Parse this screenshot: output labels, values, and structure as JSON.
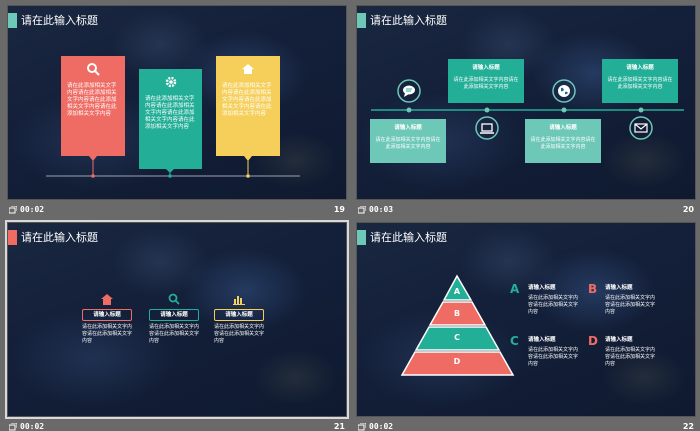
{
  "slides": [
    {
      "number": "19",
      "time": "00:02",
      "title": "请在此输入标题",
      "accent": "#6dc8b8",
      "cards": [
        {
          "text": "请在此添加相关文字内容请在此添加相关文字内容请在此添加相关文字内容请在此添加相关文字内容",
          "icon": "search-icon",
          "color": "#ef6c65"
        },
        {
          "text": "请在此添加相关文字内容请在此添加相关文字内容请在此添加相关文字内容请在此添加相关文字内容",
          "icon": "gear-icon",
          "color": "#23ae97"
        },
        {
          "text": "请在此添加相关文字内容请在此添加相关文字内容请在此添加相关文字内容请在此添加相关文字内容",
          "icon": "home-icon",
          "color": "#f5cf5a"
        }
      ]
    },
    {
      "number": "20",
      "time": "00:03",
      "title": "请在此输入标题",
      "accent": "#6dc8b8",
      "items": [
        {
          "title": "请输入标题",
          "text": "请在此添加相关文字内容请在此添加相关文字内容",
          "icon": "chat-icon"
        },
        {
          "title": "请输入标题",
          "text": "请在此添加相关文字内容请在此添加相关文字内容",
          "icon": "laptop-icon"
        },
        {
          "title": "请输入标题",
          "text": "请在此添加相关文字内容请在此添加相关文字内容",
          "icon": "globe-icon"
        },
        {
          "title": "请输入标题",
          "text": "请在此添加相关文字内容请在此添加相关文字内容",
          "icon": "mail-icon"
        }
      ]
    },
    {
      "number": "21",
      "time": "00:02",
      "title": "请在此输入标题",
      "accent": "#ef6c65",
      "items": [
        {
          "title": "请输入标题",
          "text": "请在此添加相关文字内容请在此添加相关文字内容",
          "icon": "home-icon",
          "color": "#ef6c65"
        },
        {
          "title": "请输入标题",
          "text": "请在此添加相关文字内容请在此添加相关文字内容",
          "icon": "search-icon",
          "color": "#23ae97"
        },
        {
          "title": "请输入标题",
          "text": "请在此添加相关文字内容请在此添加相关文字内容",
          "icon": "bar-chart-icon",
          "color": "#f5cf5a"
        }
      ]
    },
    {
      "number": "22",
      "time": "00:02",
      "title": "请在此输入标题",
      "accent": "#6dc8b8",
      "pyramid": [
        "A",
        "B",
        "C",
        "D"
      ],
      "items": [
        {
          "letter": "A",
          "title": "请输入标题",
          "text": "请在此添加相关文字内容请在此添加相关文字内容",
          "color": "#23ae97"
        },
        {
          "letter": "B",
          "title": "请输入标题",
          "text": "请在此添加相关文字内容请在此添加相关文字内容",
          "color": "#ef6c65"
        },
        {
          "letter": "C",
          "title": "请输入标题",
          "text": "请在此添加相关文字内容请在此添加相关文字内容",
          "color": "#23ae97"
        },
        {
          "letter": "D",
          "title": "请输入标题",
          "text": "请在此添加相关文字内容请在此添加相关文字内容",
          "color": "#ef6c65"
        }
      ]
    }
  ]
}
